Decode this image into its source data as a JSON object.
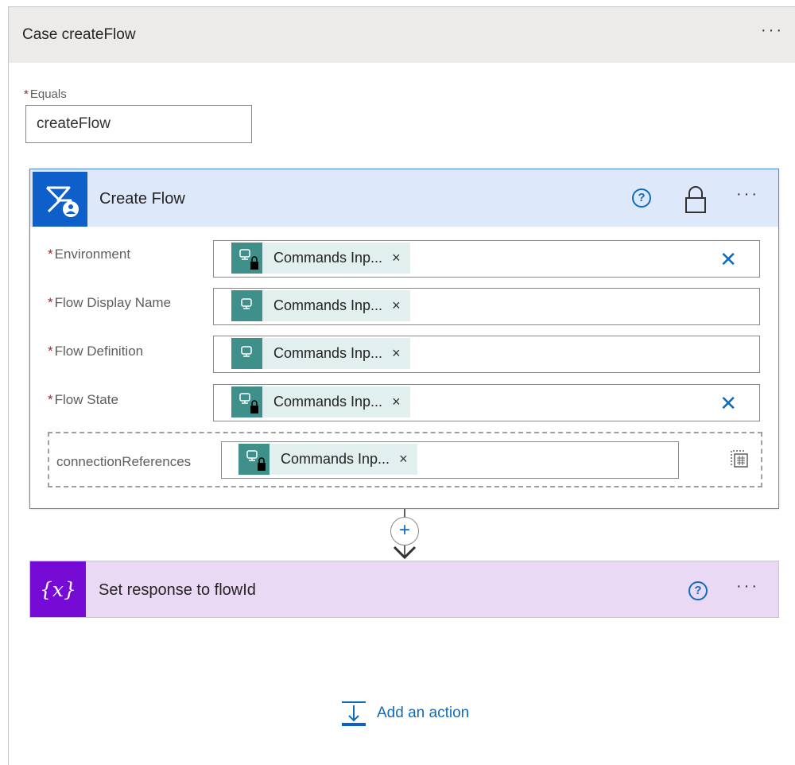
{
  "case": {
    "title": "Case createFlow",
    "equals_label": "Equals",
    "equals_required": "*",
    "equals_value": "createFlow"
  },
  "action": {
    "title": "Create Flow",
    "params": [
      {
        "label": "Environment",
        "required": "*",
        "token": "Commands Inp...",
        "token_close": "×",
        "locked": true,
        "clearable": true
      },
      {
        "label": "Flow Display Name",
        "required": "*",
        "token": "Commands Inp...",
        "token_close": "×",
        "locked": false,
        "clearable": false
      },
      {
        "label": "Flow Definition",
        "required": "*",
        "token": "Commands Inp...",
        "token_close": "×",
        "locked": false,
        "clearable": false
      },
      {
        "label": "Flow State",
        "required": "*",
        "token": "Commands Inp...",
        "token_close": "×",
        "locked": true,
        "clearable": true
      }
    ],
    "connection_references": {
      "label": "connectionReferences",
      "token": "Commands Inp...",
      "token_close": "×"
    }
  },
  "next_action": {
    "title": "Set response to flowId",
    "icon_text": "{x}"
  },
  "footer": {
    "add_action_label": "Add an action"
  },
  "glyphs": {
    "ellipsis": "···",
    "help": "?",
    "plus": "+",
    "clear": "✕"
  },
  "colors": {
    "case_header_bg": "#edebe9",
    "action_header_bg": "#dde9fb",
    "action_icon_bg": "#0f5fcb",
    "token_bg": "#e1efef",
    "token_icon_bg": "#3f8f8a",
    "variable_card_bg": "#ead9f5",
    "variable_icon_bg": "#770bd6",
    "link_blue": "#0f6cbd",
    "required_red": "#a4262c"
  }
}
